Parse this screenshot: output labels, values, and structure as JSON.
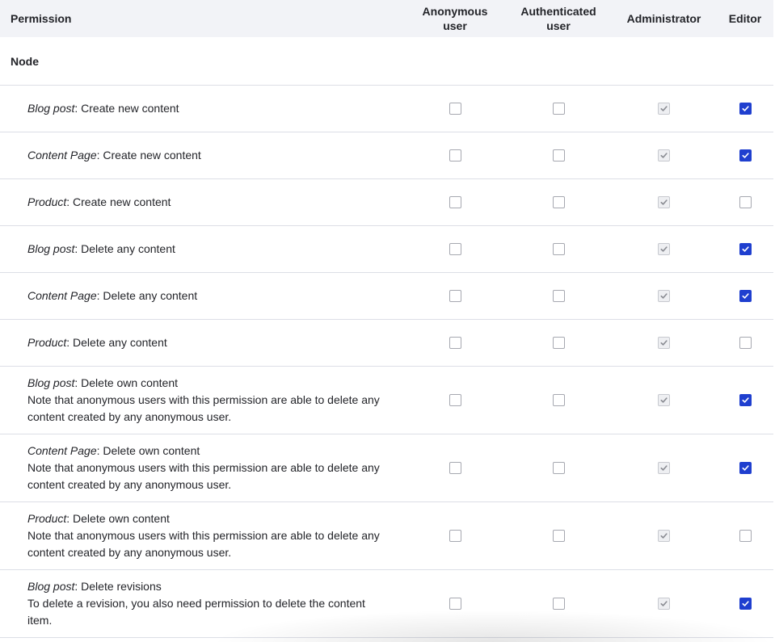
{
  "columns": {
    "permission": "Permission",
    "roles": [
      "Anonymous user",
      "Authenticated user",
      "Administrator",
      "Editor"
    ]
  },
  "module": "Node",
  "rows": [
    {
      "bundle": "Blog post",
      "action": ": Create new content",
      "note": "",
      "anonymous": false,
      "authenticated": false,
      "administrator": true,
      "editor": true
    },
    {
      "bundle": "Content Page",
      "action": ": Create new content",
      "note": "",
      "anonymous": false,
      "authenticated": false,
      "administrator": true,
      "editor": true
    },
    {
      "bundle": "Product",
      "action": ": Create new content",
      "note": "",
      "anonymous": false,
      "authenticated": false,
      "administrator": true,
      "editor": false
    },
    {
      "bundle": "Blog post",
      "action": ": Delete any content",
      "note": "",
      "anonymous": false,
      "authenticated": false,
      "administrator": true,
      "editor": true
    },
    {
      "bundle": "Content Page",
      "action": ": Delete any content",
      "note": "",
      "anonymous": false,
      "authenticated": false,
      "administrator": true,
      "editor": true
    },
    {
      "bundle": "Product",
      "action": ": Delete any content",
      "note": "",
      "anonymous": false,
      "authenticated": false,
      "administrator": true,
      "editor": false
    },
    {
      "bundle": "Blog post",
      "action": ": Delete own content",
      "note": "Note that anonymous users with this permission are able to delete any content created by any anonymous user.",
      "anonymous": false,
      "authenticated": false,
      "administrator": true,
      "editor": true
    },
    {
      "bundle": "Content Page",
      "action": ": Delete own content",
      "note": "Note that anonymous users with this permission are able to delete any content created by any anonymous user.",
      "anonymous": false,
      "authenticated": false,
      "administrator": true,
      "editor": true
    },
    {
      "bundle": "Product",
      "action": ": Delete own content",
      "note": "Note that anonymous users with this permission are able to delete any content created by any anonymous user.",
      "anonymous": false,
      "authenticated": false,
      "administrator": true,
      "editor": false
    },
    {
      "bundle": "Blog post",
      "action": ": Delete revisions",
      "note": "To delete a revision, you also need permission to delete the content item.",
      "anonymous": false,
      "authenticated": false,
      "administrator": true,
      "editor": true
    }
  ],
  "colors": {
    "checked": "#1f3fcf",
    "header_bg": "#f2f3f7",
    "border": "#dcdee6"
  }
}
